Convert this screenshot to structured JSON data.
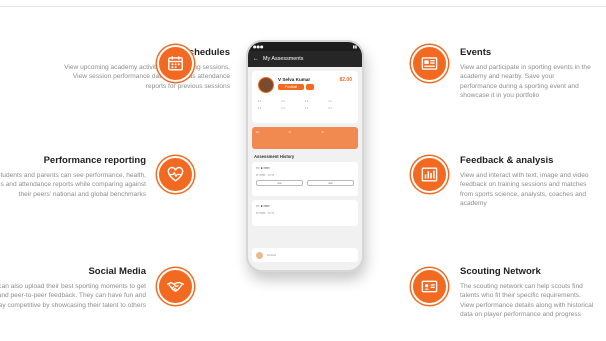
{
  "features": {
    "schedules": {
      "title": "Schedules",
      "desc": "View upcoming academy activities and training sessions. View session performance data as well as attendance reports for previous sessions",
      "icon": "calendar-icon"
    },
    "performance": {
      "title": "Performance reporting",
      "desc": "Students and parents can see performance, health, progress and attendance reports while comparing against their peers' national and global benchmarks",
      "icon": "heart-pulse-icon"
    },
    "social": {
      "title": "Social Media",
      "desc": "Students can also upload their best sporting moments to get social and peer-to-peer feedback. They can have fun and stay competitive by showcasing their talent to others",
      "icon": "handshake-icon"
    },
    "events": {
      "title": "Events",
      "desc": "View and participate in sporting events in the academy and nearby. Save your performance during a sporting event and showcase it in you portfolio",
      "icon": "newspaper-icon"
    },
    "feedback": {
      "title": "Feedback & analysis",
      "desc": "View and interact with text, image and video feedback on training sessions and matches from sports science, analysts, coaches and academy",
      "icon": "bar-chart-icon"
    },
    "scouting": {
      "title": "Scouting Network",
      "desc": "The scouting network can help scouts find talents who fit their specific requirements. View performance details along with historical data on player performance and progress",
      "icon": "id-card-icon"
    }
  },
  "phone": {
    "appbar_title": "My Assessments",
    "player_name": "V Selva Kumar",
    "badge_label": "Football",
    "score": "82.00",
    "section_title": "Assessment History",
    "accent": "#f26a21"
  }
}
